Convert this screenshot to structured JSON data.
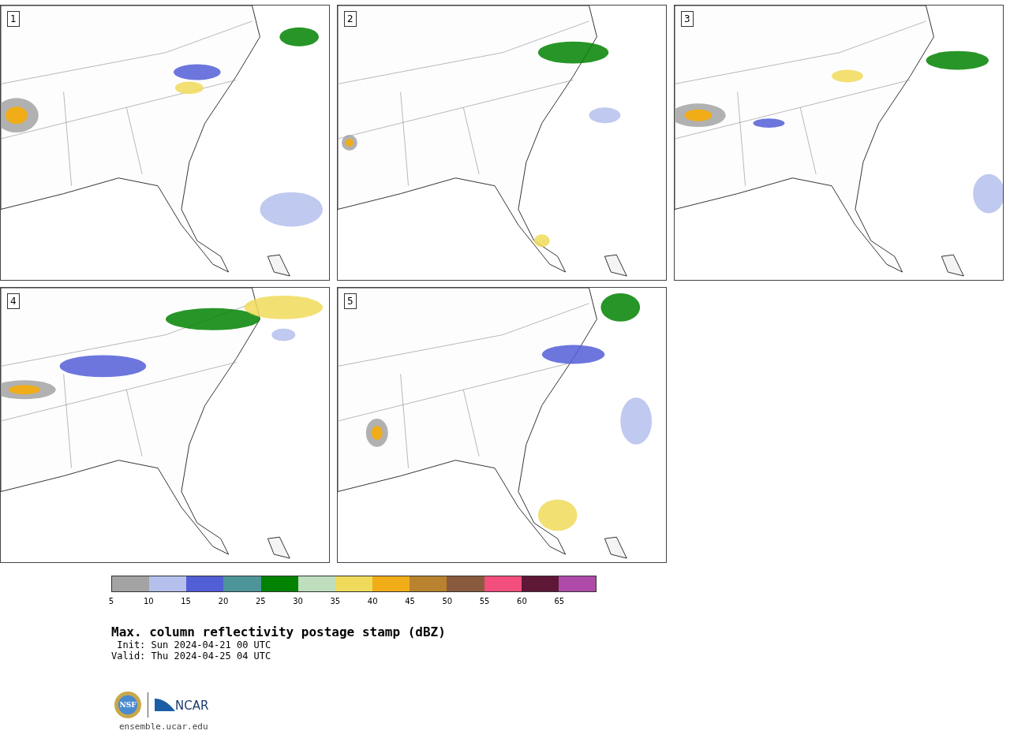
{
  "panels": [
    {
      "label": "1"
    },
    {
      "label": "2"
    },
    {
      "label": "3"
    },
    {
      "label": "4"
    },
    {
      "label": "5"
    }
  ],
  "colorbar": {
    "segments": [
      {
        "color": "#a3a3a3"
      },
      {
        "color": "#b5c0ec"
      },
      {
        "color": "#525ed6"
      },
      {
        "color": "#4e959a"
      },
      {
        "color": "#018201"
      },
      {
        "color": "#bedebe"
      },
      {
        "color": "#f0da5b"
      },
      {
        "color": "#f0ad18"
      },
      {
        "color": "#b8822e"
      },
      {
        "color": "#895a3e"
      },
      {
        "color": "#f24f7c"
      },
      {
        "color": "#5f1737"
      },
      {
        "color": "#ae4ba8"
      }
    ],
    "ticks": [
      "5",
      "10",
      "15",
      "20",
      "25",
      "30",
      "35",
      "40",
      "45",
      "50",
      "55",
      "60",
      "65"
    ]
  },
  "title": "Max. column reflectivity postage stamp (dBZ)",
  "init": " Init: Sun 2024-04-21 00 UTC",
  "valid": "Valid: Thu 2024-04-25 04 UTC",
  "logo": {
    "left": "NSF",
    "right": "NCAR"
  },
  "footer_link": "ensemble.ucar.edu"
}
